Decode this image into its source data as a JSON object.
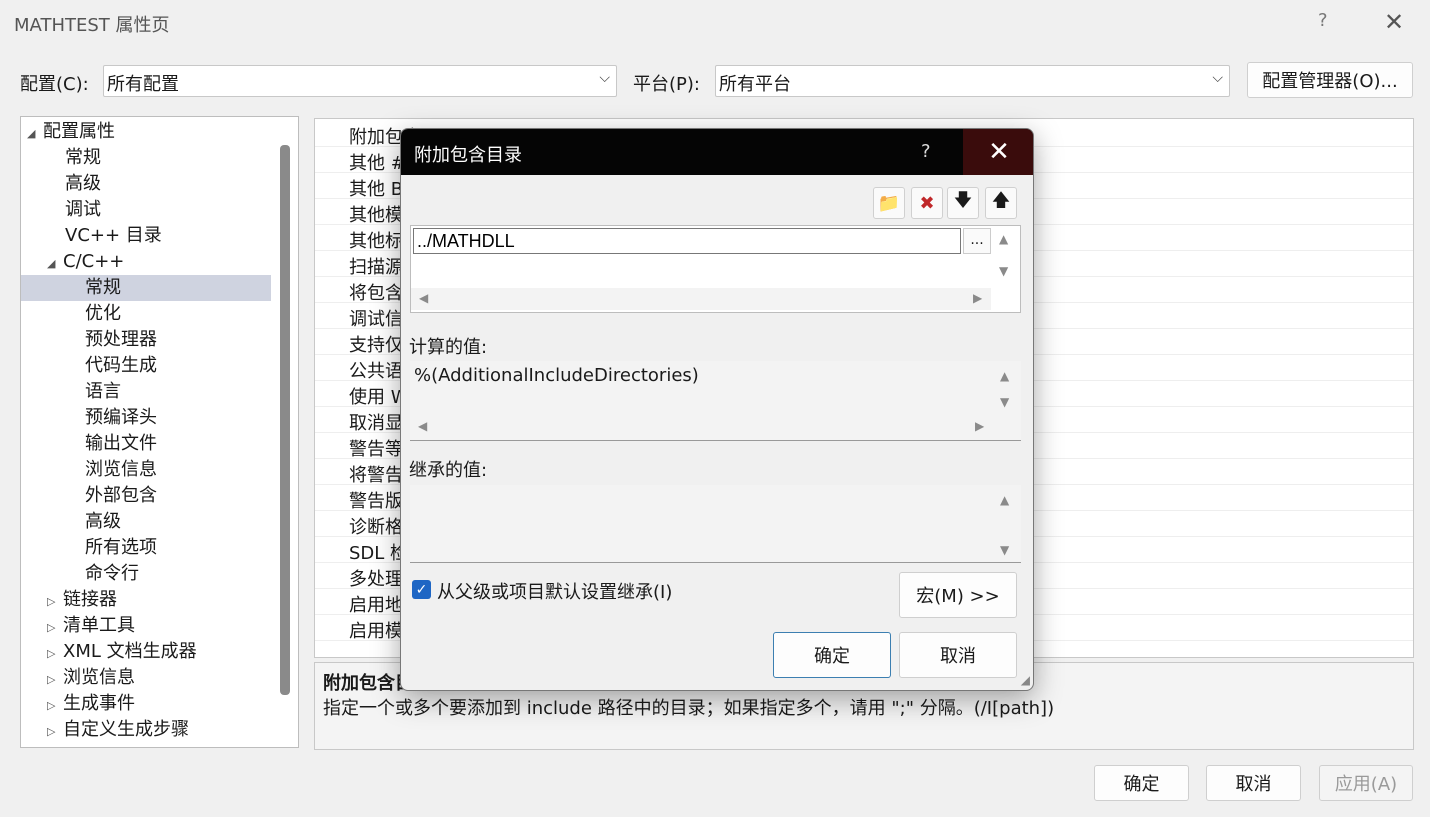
{
  "window": {
    "title": "MATHTEST 属性页",
    "help": "?",
    "close": "✕"
  },
  "config": {
    "label": "配置(C):",
    "value": "所有配置"
  },
  "platform": {
    "label": "平台(P):",
    "value": "所有平台"
  },
  "config_manager": "配置管理器(O)...",
  "tree": {
    "items": [
      {
        "label": "配置属性",
        "exp": "◢",
        "selected": false
      },
      {
        "label": "常规",
        "exp": "",
        "selected": false
      },
      {
        "label": "高级",
        "exp": "",
        "selected": false
      },
      {
        "label": "调试",
        "exp": "",
        "selected": false
      },
      {
        "label": "VC++ 目录",
        "exp": "",
        "selected": false
      },
      {
        "label": "C/C++",
        "exp": "◢",
        "selected": false
      },
      {
        "label": "常规",
        "exp": "",
        "selected": true
      },
      {
        "label": "优化",
        "exp": "",
        "selected": false
      },
      {
        "label": "预处理器",
        "exp": "",
        "selected": false
      },
      {
        "label": "代码生成",
        "exp": "",
        "selected": false
      },
      {
        "label": "语言",
        "exp": "",
        "selected": false
      },
      {
        "label": "预编译头",
        "exp": "",
        "selected": false
      },
      {
        "label": "输出文件",
        "exp": "",
        "selected": false
      },
      {
        "label": "浏览信息",
        "exp": "",
        "selected": false
      },
      {
        "label": "外部包含",
        "exp": "",
        "selected": false
      },
      {
        "label": "高级",
        "exp": "",
        "selected": false
      },
      {
        "label": "所有选项",
        "exp": "",
        "selected": false
      },
      {
        "label": "命令行",
        "exp": "",
        "selected": false
      },
      {
        "label": "链接器",
        "exp": "▷",
        "selected": false
      },
      {
        "label": "清单工具",
        "exp": "▷",
        "selected": false
      },
      {
        "label": "XML 文档生成器",
        "exp": "▷",
        "selected": false
      },
      {
        "label": "浏览信息",
        "exp": "▷",
        "selected": false
      },
      {
        "label": "生成事件",
        "exp": "▷",
        "selected": false
      },
      {
        "label": "自定义生成步骤",
        "exp": "▷",
        "selected": false
      }
    ]
  },
  "grid": {
    "rows": [
      "附加包含目录",
      "其他 #",
      "其他 B",
      "其他模",
      "其他标",
      "扫描源",
      "将包含",
      "调试信",
      "支持仅",
      "公共语",
      "使用 W",
      "取消显",
      "警告等",
      "将警告",
      "警告版",
      "诊断格",
      "SDL 检",
      "多处理",
      "启用地",
      "启用模"
    ]
  },
  "description": {
    "title": "附加包含目",
    "text": "指定一个或多个要添加到 include 路径中的目录；如果指定多个，请用 \";\" 分隔。(/I[path])"
  },
  "dialog": {
    "title": "附加包含目录",
    "help": "?",
    "close": "✕",
    "toolbar": {
      "new": "📁",
      "delete": "✖",
      "down": "🡇",
      "up": "🡅"
    },
    "entry": "../MATHDLL",
    "browse": "...",
    "computed_label": "计算的值:",
    "computed_value": "%(AdditionalIncludeDirectories)",
    "inherited_label": "继承的值:",
    "inherit_check": "从父级或项目默认设置继承(I)",
    "macros": "宏(M) >>",
    "ok": "确定",
    "cancel": "取消"
  },
  "footer": {
    "ok": "确定",
    "cancel": "取消",
    "apply": "应用(A)"
  }
}
